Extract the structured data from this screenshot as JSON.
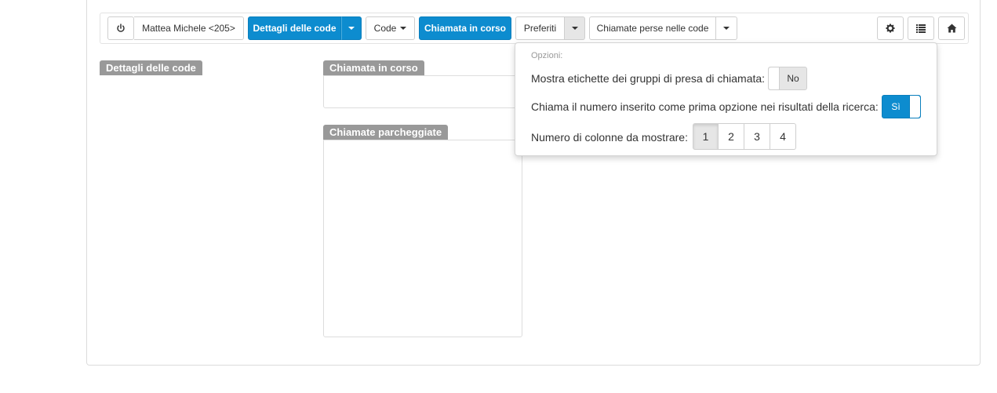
{
  "toolbar": {
    "power_icon": "power-icon",
    "user_label": "Mattea Michele <205>",
    "queue_details_label": "Dettagli delle code",
    "queues_label": "Code",
    "current_call_label": "Chiamata in corso",
    "favorites_label": "Preferiti",
    "missed_calls_label": "Chiamate perse nelle code",
    "settings_icon": "gear-icon",
    "list_icon": "list-icon",
    "home_icon": "home-icon"
  },
  "sections": {
    "queue_details": "Dettagli delle code",
    "current_call": "Chiamata in corso",
    "parked_calls": "Chiamate parcheggiate"
  },
  "options_popover": {
    "title": "Opzioni:",
    "pickup_labels": {
      "label": "Mostra etichette dei gruppi di presa di chiamata:",
      "value": "No",
      "on": false
    },
    "call_first": {
      "label": "Chiama il numero inserito come prima opzione nei risultati della ricerca:",
      "value": "Sì",
      "on": true
    },
    "columns": {
      "label": "Numero di colonne da mostrare:",
      "options": [
        "1",
        "2",
        "3",
        "4"
      ],
      "selected": "1"
    }
  },
  "colors": {
    "primary": "#0d8ccf",
    "section_label": "#999999"
  }
}
